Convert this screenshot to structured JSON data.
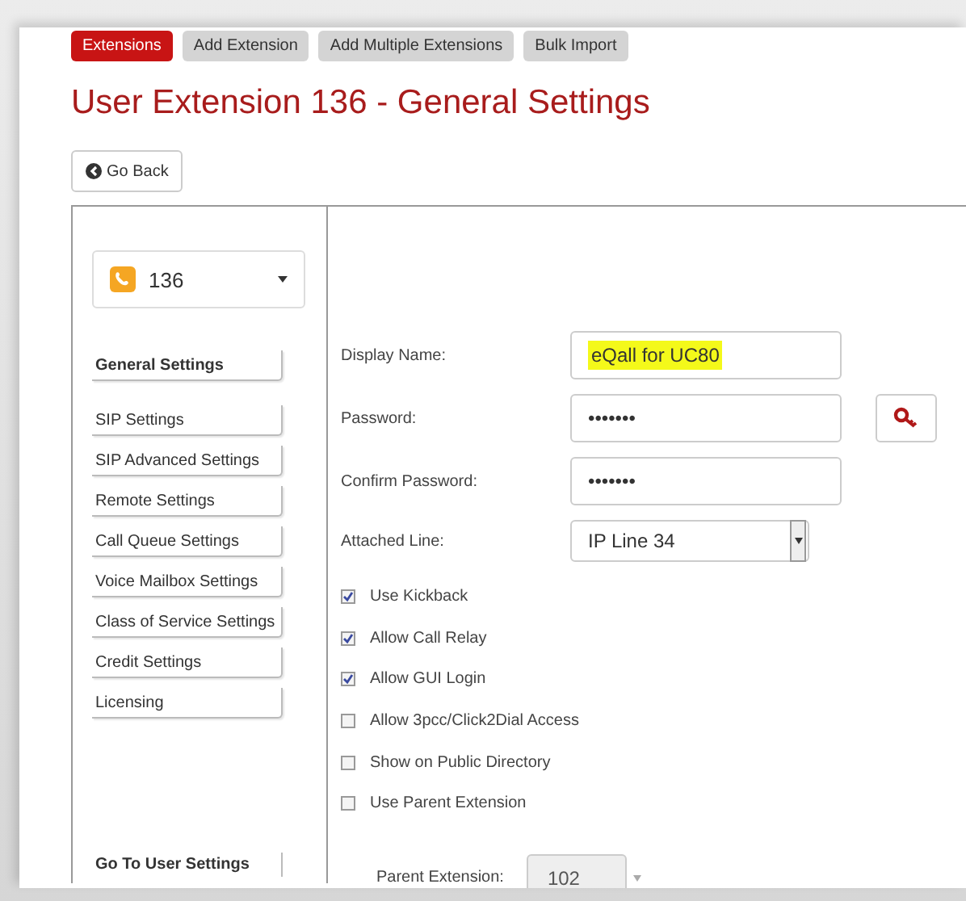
{
  "tabs": [
    {
      "label": "Extensions",
      "selected": true
    },
    {
      "label": "Add Extension",
      "selected": false
    },
    {
      "label": "Add Multiple Extensions",
      "selected": false
    },
    {
      "label": "Bulk Import",
      "selected": false
    }
  ],
  "title": "User Extension 136 - General Settings",
  "back_button": "Go Back",
  "sidebar": {
    "extension_select": "136",
    "items": [
      {
        "label": "General Settings",
        "selected": true
      },
      {
        "label": "SIP Settings",
        "selected": false
      },
      {
        "label": "SIP Advanced Settings",
        "selected": false
      },
      {
        "label": "Remote Settings",
        "selected": false
      },
      {
        "label": "Call Queue Settings",
        "selected": false
      },
      {
        "label": "Voice Mailbox Settings",
        "selected": false
      },
      {
        "label": "Class of Service Settings",
        "selected": false
      },
      {
        "label": "Credit Settings",
        "selected": false
      },
      {
        "label": "Licensing",
        "selected": false
      }
    ],
    "footer_link": "Go To User Settings"
  },
  "form": {
    "fields": [
      {
        "kind": "text",
        "label": "Display Name:",
        "value": "eQall for UC80",
        "highlighted": true
      },
      {
        "kind": "password",
        "label": "Password:",
        "value": "•••••••",
        "key_button": true
      },
      {
        "kind": "password",
        "label": "Confirm Password:",
        "value": "•••••••"
      },
      {
        "kind": "select",
        "label": "Attached Line:",
        "value": "IP Line 34"
      }
    ],
    "checkboxes": [
      {
        "label": "Use Kickback",
        "checked": true
      },
      {
        "label": "Allow Call Relay",
        "checked": true
      },
      {
        "label": "Allow GUI Login",
        "checked": true
      },
      {
        "label": "Allow 3pcc/Click2Dial Access",
        "checked": false
      },
      {
        "label": "Show on Public Directory",
        "checked": false
      },
      {
        "label": "Use Parent Extension",
        "checked": false
      }
    ],
    "parent_extension": {
      "label": "Parent Extension:",
      "value": "102",
      "disabled": true
    }
  }
}
